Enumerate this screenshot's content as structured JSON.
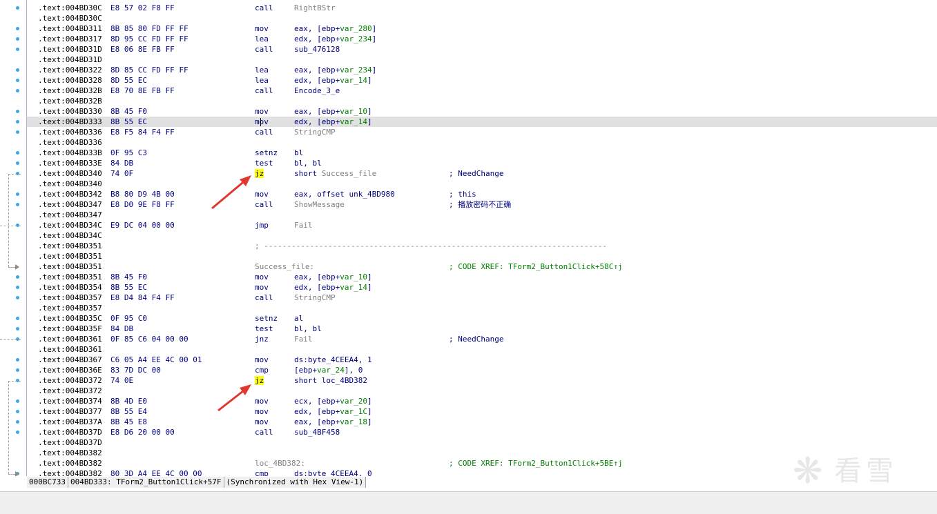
{
  "listing": [
    {
      "a": ".text:004BD30C",
      "b": "E8 57 02 F8 FF",
      "m": "call",
      "o": [
        {
          "t": "RightBStr",
          "c": "name"
        }
      ],
      "k": ""
    },
    {
      "a": ".text:004BD30C"
    },
    {
      "a": ".text:004BD311",
      "b": "8B 85 80 FD FF FF",
      "m": "mov",
      "o": [
        {
          "t": "eax, [ebp+"
        },
        {
          "t": "var_280",
          "c": "var"
        },
        {
          "t": "]"
        }
      ]
    },
    {
      "a": ".text:004BD317",
      "b": "8D 95 CC FD FF FF",
      "m": "lea",
      "o": [
        {
          "t": "edx, [ebp+"
        },
        {
          "t": "var_234",
          "c": "var"
        },
        {
          "t": "]"
        }
      ]
    },
    {
      "a": ".text:004BD31D",
      "b": "E8 06 8E FB FF",
      "m": "call",
      "o": [
        {
          "t": "sub_476128"
        }
      ]
    },
    {
      "a": ".text:004BD31D"
    },
    {
      "a": ".text:004BD322",
      "b": "8D 85 CC FD FF FF",
      "m": "lea",
      "o": [
        {
          "t": "eax, [ebp+"
        },
        {
          "t": "var_234",
          "c": "var"
        },
        {
          "t": "]"
        }
      ]
    },
    {
      "a": ".text:004BD328",
      "b": "8D 55 EC",
      "m": "lea",
      "o": [
        {
          "t": "edx, [ebp+"
        },
        {
          "t": "var_14",
          "c": "var"
        },
        {
          "t": "]"
        }
      ]
    },
    {
      "a": ".text:004BD32B",
      "b": "E8 70 8E FB FF",
      "m": "call",
      "o": [
        {
          "t": "Encode_3_e"
        }
      ]
    },
    {
      "a": ".text:004BD32B"
    },
    {
      "a": ".text:004BD330",
      "b": "8B 45 F0",
      "m": "mov",
      "o": [
        {
          "t": "eax, [ebp+"
        },
        {
          "t": "var_10",
          "c": "var"
        },
        {
          "t": "]"
        }
      ]
    },
    {
      "a": ".text:004BD333",
      "b": "8B 55 EC",
      "m": "mov",
      "o": [
        {
          "t": "edx, [ebp+"
        },
        {
          "t": "var_14",
          "c": "var"
        },
        {
          "t": "]"
        }
      ],
      "hl": true
    },
    {
      "a": ".text:004BD336",
      "b": "E8 F5 84 F4 FF",
      "m": "call",
      "o": [
        {
          "t": "StringCMP",
          "c": "name"
        }
      ]
    },
    {
      "a": ".text:004BD336"
    },
    {
      "a": ".text:004BD33B",
      "b": "0F 95 C3",
      "m": "setnz",
      "o": [
        {
          "t": "bl"
        }
      ]
    },
    {
      "a": ".text:004BD33E",
      "b": "84 DB",
      "m": "test",
      "o": [
        {
          "t": "bl, bl"
        }
      ]
    },
    {
      "a": ".text:004BD340",
      "b": "74 0F",
      "m": "jz",
      "o": [
        {
          "t": "short "
        },
        {
          "t": "Success_file",
          "c": "name"
        }
      ],
      "k": "; NeedChange",
      "mark": true
    },
    {
      "a": ".text:004BD340"
    },
    {
      "a": ".text:004BD342",
      "b": "B8 80 D9 4B 00",
      "m": "mov",
      "o": [
        {
          "t": "eax, offset unk_4BD980"
        }
      ],
      "k": "; this"
    },
    {
      "a": ".text:004BD347",
      "b": "E8 D0 9E F8 FF",
      "m": "call",
      "o": [
        {
          "t": "ShowMessage",
          "c": "name"
        }
      ],
      "k": "; 播放密码不正确"
    },
    {
      "a": ".text:004BD347"
    },
    {
      "a": ".text:004BD34C",
      "b": "E9 DC 04 00 00",
      "m": "jmp",
      "o": [
        {
          "t": "Fail",
          "c": "name"
        }
      ]
    },
    {
      "a": ".text:004BD34C"
    },
    {
      "a": ".text:004BD351",
      "sep": "; ---------------------------------------------------------------------------"
    },
    {
      "a": ".text:004BD351"
    },
    {
      "a": ".text:004BD351",
      "lbl": "Success_file:",
      "lk": "; CODE XREF: TForm2_Button1Click+58C↑j"
    },
    {
      "a": ".text:004BD351",
      "b": "8B 45 F0",
      "m": "mov",
      "o": [
        {
          "t": "eax, [ebp+"
        },
        {
          "t": "var_10",
          "c": "var"
        },
        {
          "t": "]"
        }
      ]
    },
    {
      "a": ".text:004BD354",
      "b": "8B 55 EC",
      "m": "mov",
      "o": [
        {
          "t": "edx, [ebp+"
        },
        {
          "t": "var_14",
          "c": "var"
        },
        {
          "t": "]"
        }
      ]
    },
    {
      "a": ".text:004BD357",
      "b": "E8 D4 84 F4 FF",
      "m": "call",
      "o": [
        {
          "t": "StringCMP",
          "c": "name"
        }
      ]
    },
    {
      "a": ".text:004BD357"
    },
    {
      "a": ".text:004BD35C",
      "b": "0F 95 C0",
      "m": "setnz",
      "o": [
        {
          "t": "al"
        }
      ]
    },
    {
      "a": ".text:004BD35F",
      "b": "84 DB",
      "m": "test",
      "o": [
        {
          "t": "bl, bl"
        }
      ]
    },
    {
      "a": ".text:004BD361",
      "b": "0F 85 C6 04 00 00",
      "m": "jnz",
      "o": [
        {
          "t": "Fail",
          "c": "name"
        }
      ],
      "k": "; NeedChange"
    },
    {
      "a": ".text:004BD361"
    },
    {
      "a": ".text:004BD367",
      "b": "C6 05 A4 EE 4C 00 01",
      "m": "mov",
      "o": [
        {
          "t": "ds:byte_4CEEA4, 1"
        }
      ]
    },
    {
      "a": ".text:004BD36E",
      "b": "83 7D DC 00",
      "m": "cmp",
      "o": [
        {
          "t": "[ebp+"
        },
        {
          "t": "var_24",
          "c": "var"
        },
        {
          "t": "], 0"
        }
      ]
    },
    {
      "a": ".text:004BD372",
      "b": "74 0E",
      "m": "jz",
      "o": [
        {
          "t": "short loc_4BD382"
        }
      ],
      "mark": true
    },
    {
      "a": ".text:004BD372"
    },
    {
      "a": ".text:004BD374",
      "b": "8B 4D E0",
      "m": "mov",
      "o": [
        {
          "t": "ecx, [ebp+"
        },
        {
          "t": "var_20",
          "c": "var"
        },
        {
          "t": "]"
        }
      ]
    },
    {
      "a": ".text:004BD377",
      "b": "8B 55 E4",
      "m": "mov",
      "o": [
        {
          "t": "edx, [ebp+"
        },
        {
          "t": "var_1C",
          "c": "var"
        },
        {
          "t": "]"
        }
      ]
    },
    {
      "a": ".text:004BD37A",
      "b": "8B 45 E8",
      "m": "mov",
      "o": [
        {
          "t": "eax, [ebp+"
        },
        {
          "t": "var_18",
          "c": "var"
        },
        {
          "t": "]"
        }
      ]
    },
    {
      "a": ".text:004BD37D",
      "b": "E8 D6 20 00 00",
      "m": "call",
      "o": [
        {
          "t": "sub_4BF458"
        }
      ]
    },
    {
      "a": ".text:004BD37D"
    },
    {
      "a": ".text:004BD382"
    },
    {
      "a": ".text:004BD382",
      "lbl": "loc_4BD382:",
      "lk": "; CODE XREF: TForm2_Button1Click+5BE↑j"
    },
    {
      "a": ".text:004BD382",
      "b": "80 3D A4 EE 4C 00 00",
      "m": "cmp",
      "o": [
        {
          "t": "ds:byte_4CEEA4, 0"
        }
      ]
    }
  ],
  "status": {
    "offset": "000BC733",
    "location": "004BD333: TForm2_Button1Click+57F",
    "sync": "(Synchronized with Hex View-1)"
  },
  "watermark": {
    "text": "看雪"
  },
  "colors": {
    "arrow": "#e0382f",
    "highlight_line": "#e1e1e1",
    "jz_mark": "#ffff00",
    "dot": "#3aa6e8"
  }
}
